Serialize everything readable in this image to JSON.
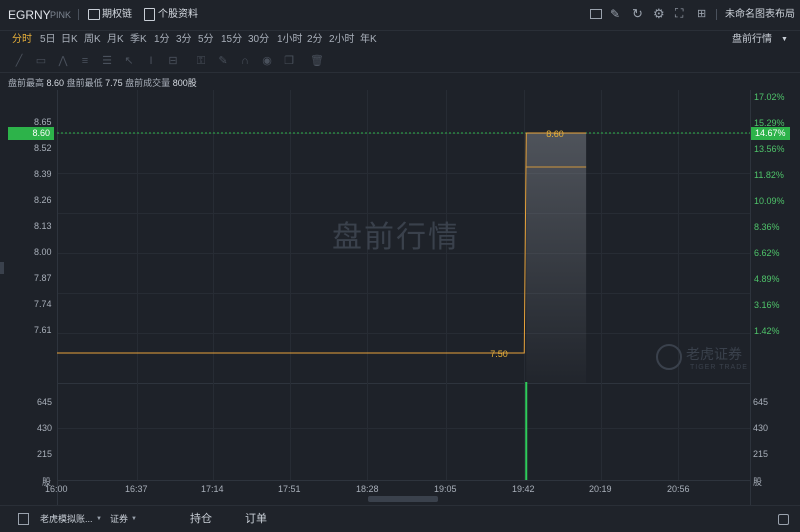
{
  "header": {
    "symbol": "EGRNY",
    "market": "PINK",
    "options_chain": "期权链",
    "stock_info": "个股资料",
    "layout_name": "未命名图表布局"
  },
  "periods": [
    "分时",
    "5日",
    "日K",
    "周K",
    "月K",
    "季K",
    "1分",
    "3分",
    "5分",
    "15分",
    "30分",
    "1小时",
    "2分",
    "2小时",
    "年K"
  ],
  "active_period": "分时",
  "session_selector": "盘前行情",
  "summary": {
    "high_label": "盘前最高",
    "high": "8.60",
    "low_label": "盘前最低",
    "low": "7.75",
    "vol_label": "盘前成交量",
    "vol": "800股"
  },
  "price_axis": [
    "8.65",
    "8.52",
    "8.39",
    "8.26",
    "8.13",
    "8.00",
    "7.87",
    "7.74",
    "7.61"
  ],
  "pct_axis": [
    "17.02%",
    "15.29%",
    "13.56%",
    "11.82%",
    "10.09%",
    "8.36%",
    "6.62%",
    "4.89%",
    "3.16%",
    "1.42%"
  ],
  "volume_axis": [
    "645",
    "430",
    "215"
  ],
  "volume_unit": "股",
  "time_axis": [
    "16:00",
    "16:37",
    "17:14",
    "17:51",
    "18:28",
    "19:05",
    "19:42",
    "20:19",
    "20:56"
  ],
  "current_price_tag": "8.60",
  "current_pct_tag": "14.67%",
  "watermark": "盘前行情",
  "logo": {
    "name": "老虎证券",
    "sub": "TIGER TRADE"
  },
  "bottom": {
    "account": "老虎模拟账...",
    "account_type": "证券",
    "positions": "持仓",
    "orders": "订单"
  },
  "chart_data": {
    "type": "line",
    "title": "盘前行情",
    "x": [
      "16:00",
      "19:42",
      "19:42",
      "20:19"
    ],
    "series": [
      {
        "values": [
          7.5,
          7.5,
          8.6,
          8.6
        ]
      }
    ],
    "point_labels": [
      "7.50",
      "8.60"
    ],
    "ylim": [
      7.5,
      8.72
    ],
    "volume_bar": {
      "x": "19:42",
      "value": 800
    },
    "colors": {
      "price": "#e8a33a",
      "volume": "#2ecc5a",
      "price_tag": "#2db34a"
    }
  }
}
